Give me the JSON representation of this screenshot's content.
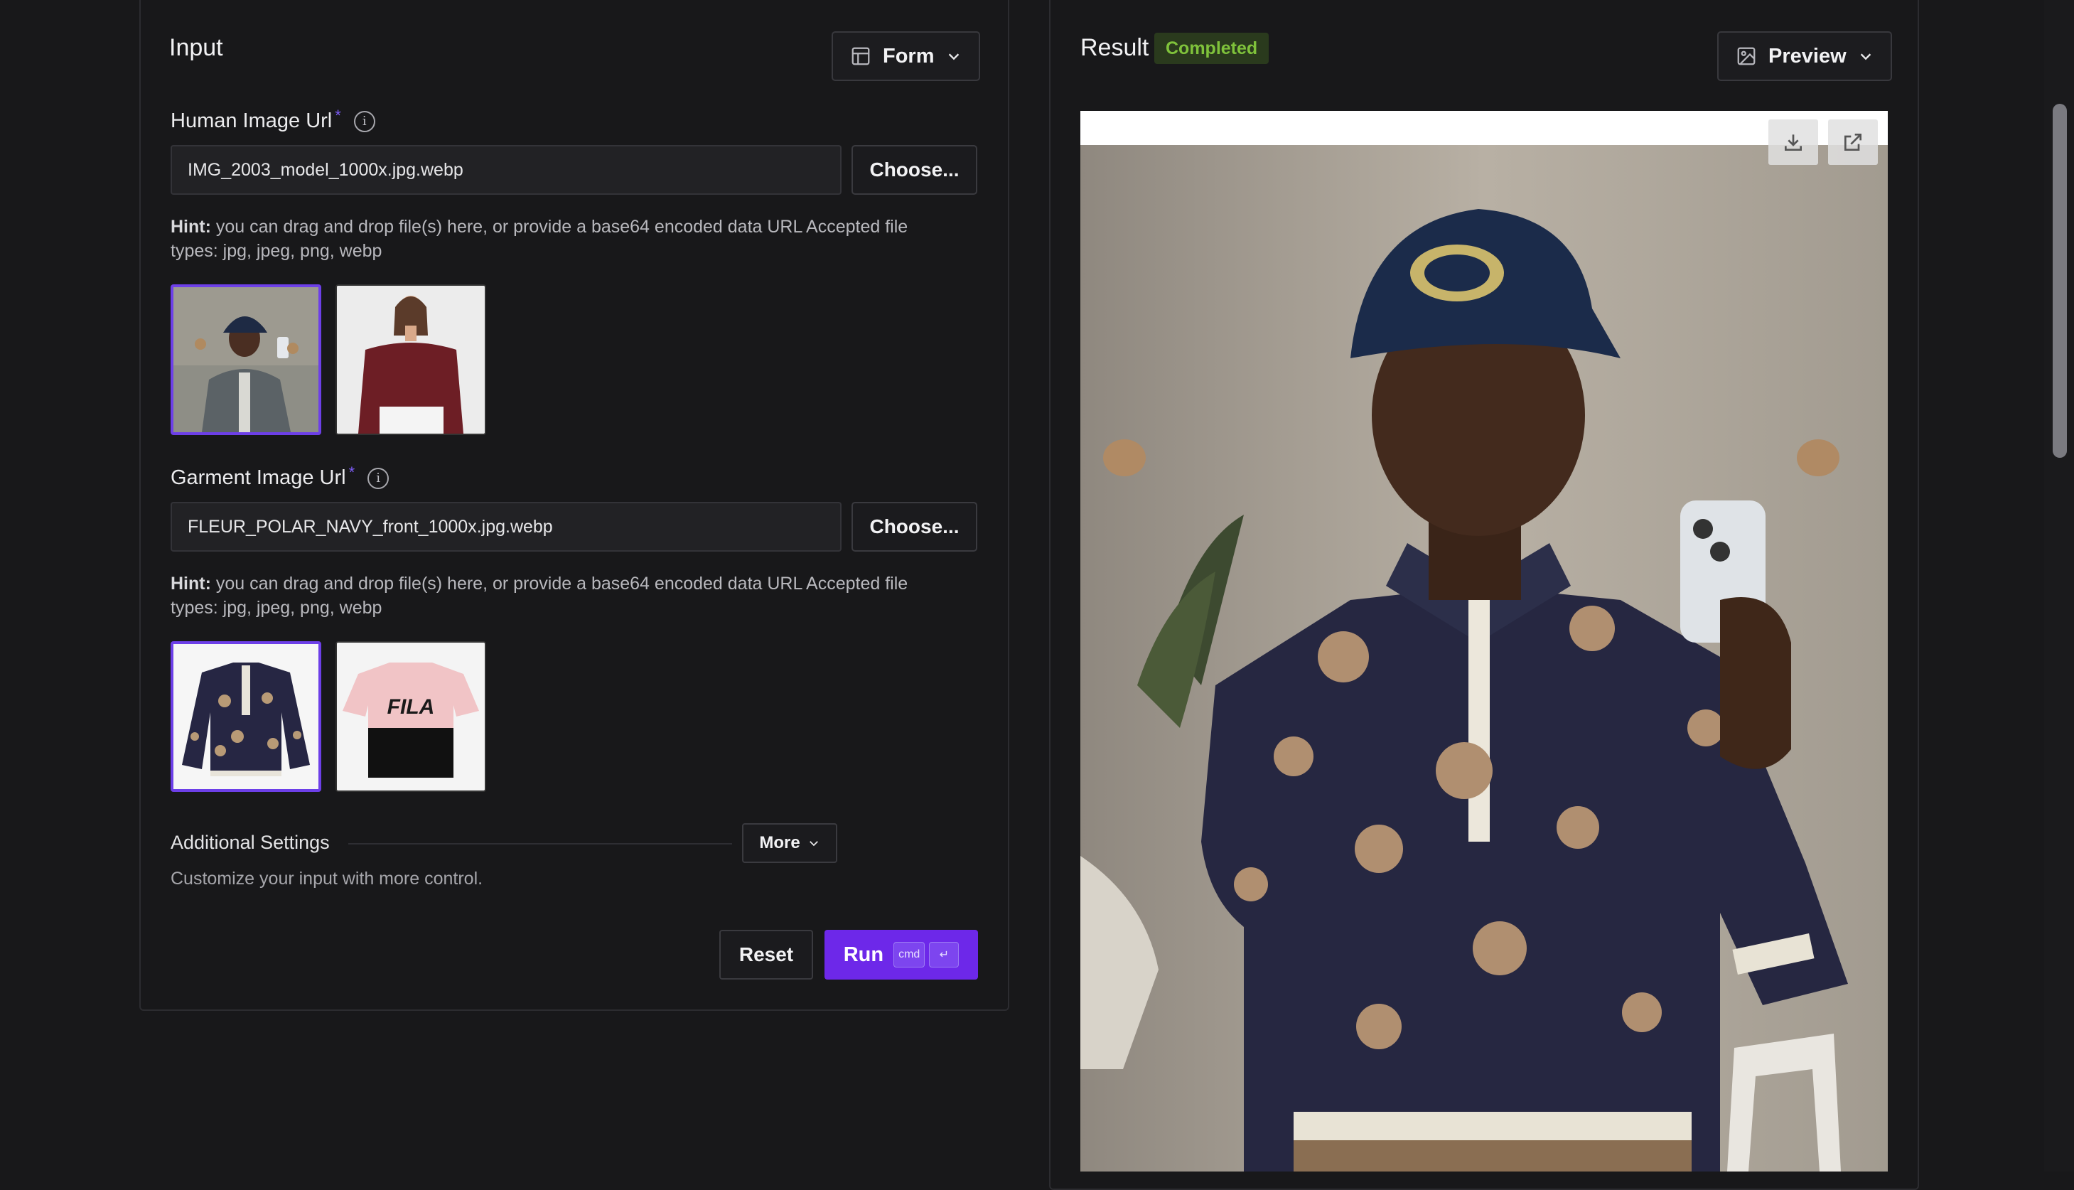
{
  "input": {
    "title": "Input",
    "view_mode": "Form",
    "human_image": {
      "label": "Human Image Url",
      "required_mark": "*",
      "value": "IMG_2003_model_1000x.jpg.webp",
      "choose_label": "Choose...",
      "hint_prefix": "Hint:",
      "hint_text": " you can drag and drop file(s) here, or provide a base64 encoded data URL Accepted file types: jpg, jpeg, png, webp"
    },
    "garment_image": {
      "label": "Garment Image Url",
      "required_mark": "*",
      "value": "FLEUR_POLAR_NAVY_front_1000x.jpg.webp",
      "choose_label": "Choose...",
      "hint_prefix": "Hint:",
      "hint_text": " you can drag and drop file(s) here, or provide a base64 encoded data URL Accepted file types: jpg, jpeg, png, webp"
    },
    "additional_settings": {
      "title": "Additional Settings",
      "description": "Customize your input with more control.",
      "more_label": "More"
    },
    "reset_label": "Reset",
    "run_label": "Run",
    "shortcut_keys": [
      "cmd",
      "↵"
    ]
  },
  "result": {
    "title": "Result",
    "status": "Completed",
    "view_mode": "Preview"
  },
  "colors": {
    "accent": "#6d28e9",
    "status_green": "#7fc23b",
    "background": "#18181a"
  },
  "icons": [
    "layout-icon",
    "chevron-down-icon",
    "info-icon",
    "image-icon",
    "download-icon",
    "external-link-icon"
  ]
}
